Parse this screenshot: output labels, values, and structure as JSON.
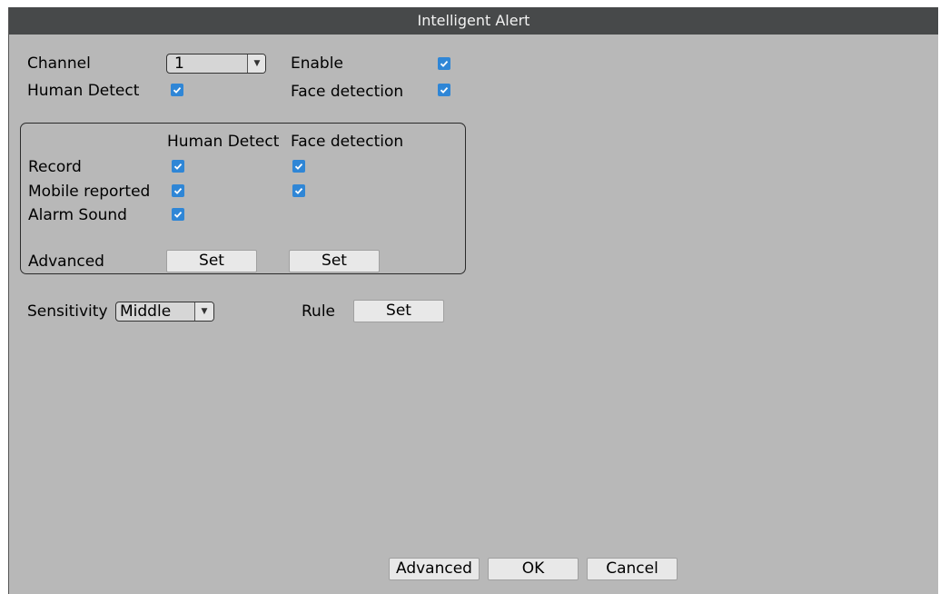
{
  "window": {
    "title": "Intelligent Alert"
  },
  "top": {
    "channel_label": "Channel",
    "channel_value": "1",
    "enable_label": "Enable",
    "enable_checked": true,
    "human_detect_label": "Human Detect",
    "human_detect_checked": true,
    "face_detection_label": "Face detection",
    "face_detection_checked": true
  },
  "actions": {
    "column_human": "Human Detect",
    "column_face": "Face detection",
    "rows": [
      {
        "label": "Record",
        "human": true,
        "face": true
      },
      {
        "label": "Mobile reported",
        "human": true,
        "face": true
      },
      {
        "label": "Alarm Sound",
        "human": true
      }
    ],
    "advanced_label": "Advanced",
    "set_label": "Set"
  },
  "bottom": {
    "sensitivity_label": "Sensitivity",
    "sensitivity_value": "Middle",
    "rule_label": "Rule",
    "rule_set_label": "Set"
  },
  "footer": {
    "advanced_label": "Advanced",
    "ok_label": "OK",
    "cancel_label": "Cancel"
  },
  "colors": {
    "titlebar": "#47494a",
    "panel": "#b8b8b8",
    "checkbox": "#2f86d6",
    "button": "#e8e8e8"
  }
}
